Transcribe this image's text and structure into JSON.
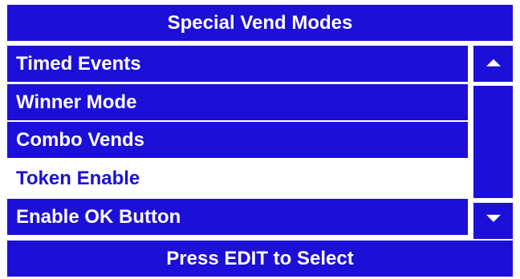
{
  "header": {
    "title": "Special Vend Modes"
  },
  "menu": {
    "items": [
      {
        "label": "Timed Events"
      },
      {
        "label": "Winner Mode"
      },
      {
        "label": "Combo Vends"
      },
      {
        "label": "Token Enable",
        "selected": true
      },
      {
        "label": "Enable OK Button"
      }
    ]
  },
  "scrollbar": {
    "up_icon": "triangle-up-icon",
    "down_icon": "triangle-down-icon"
  },
  "footer": {
    "hint": "Press EDIT to Select"
  },
  "colors": {
    "accent": "#1c0fd8",
    "text_on_accent": "#ffffff",
    "background": "#ffffff"
  }
}
